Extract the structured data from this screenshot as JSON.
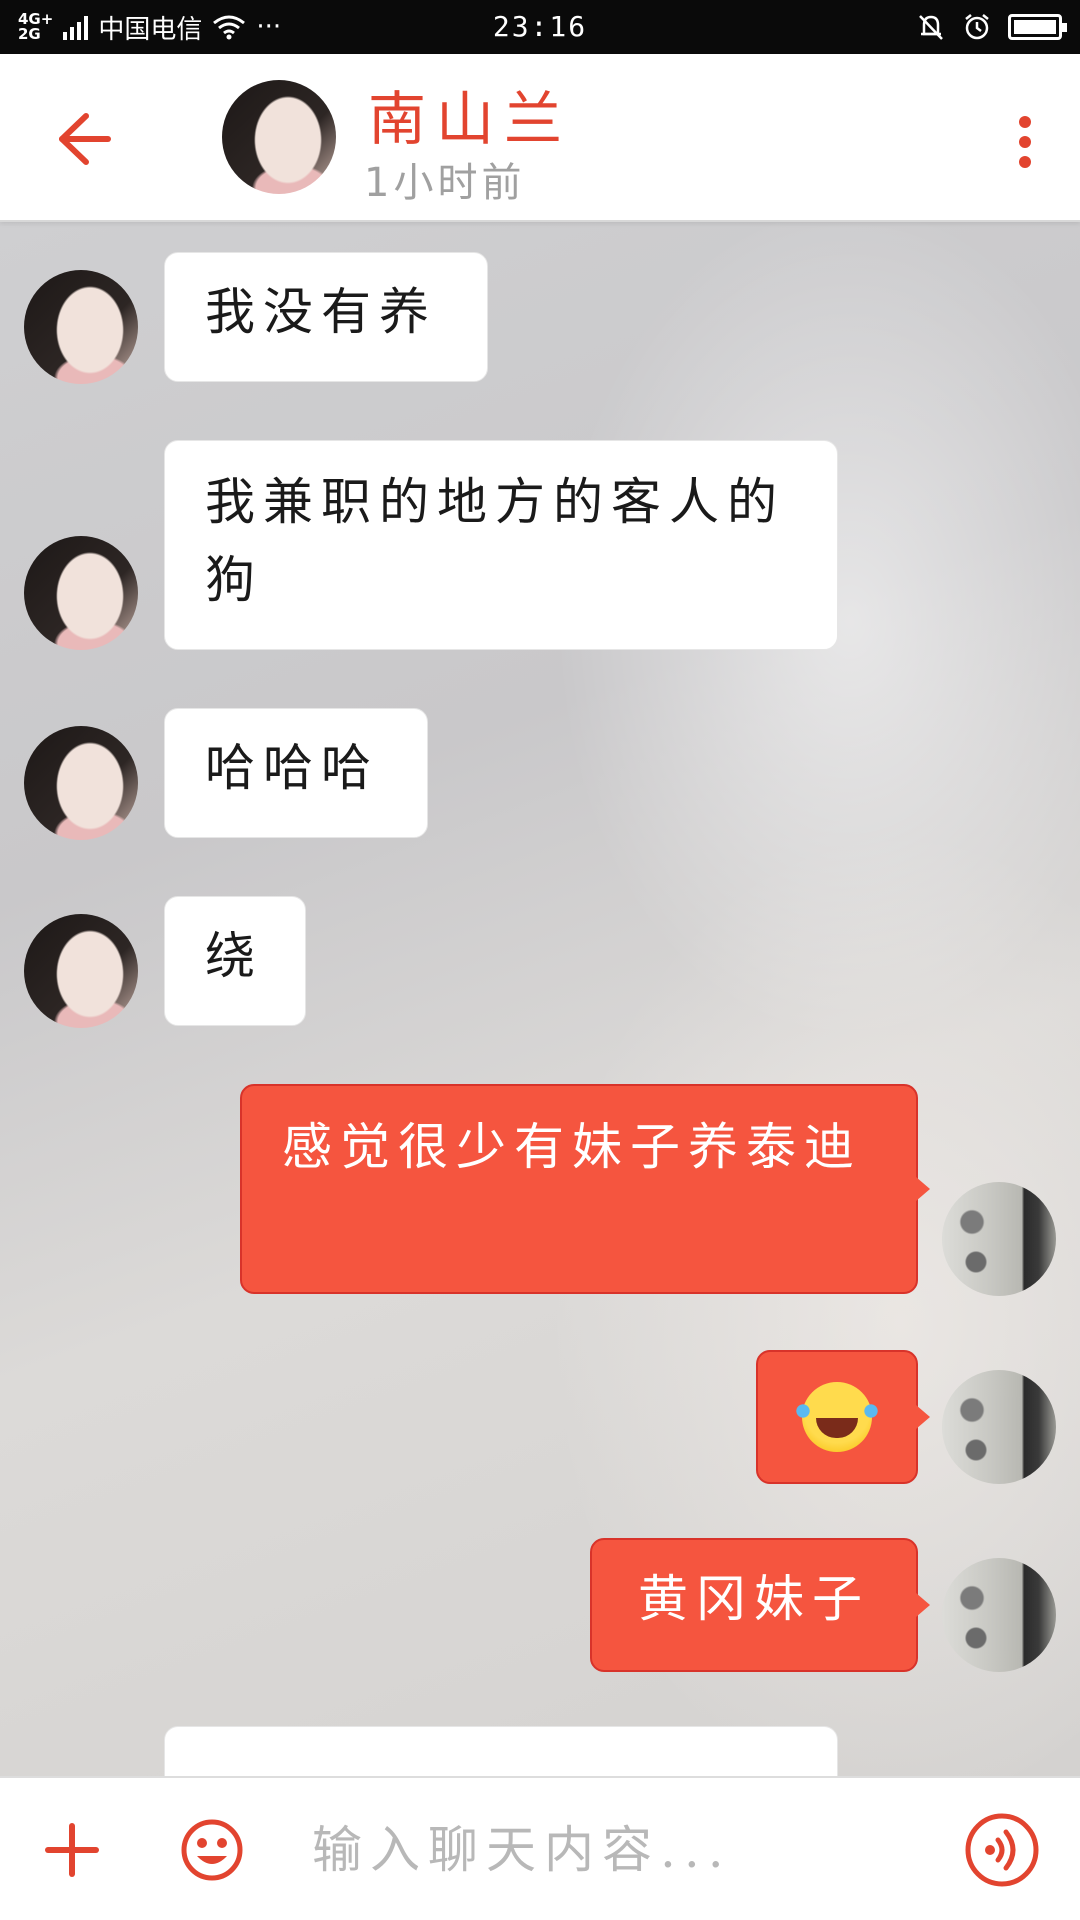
{
  "status_bar": {
    "network": [
      "4G+",
      "2G"
    ],
    "carrier": "中国电信",
    "more": "···",
    "time": "23:16"
  },
  "header": {
    "contact_name": "南山兰",
    "last_seen": "1小时前"
  },
  "messages": [
    {
      "side": "in",
      "text": "我没有养"
    },
    {
      "side": "in",
      "text": "我兼职的地方的客人的狗"
    },
    {
      "side": "in",
      "text": "哈哈哈"
    },
    {
      "side": "in",
      "text": "绕"
    },
    {
      "side": "out",
      "text": "感觉很少有妹子养泰迪"
    },
    {
      "side": "out",
      "text": "",
      "emoji": "face-with-tears-of-joy-icon"
    },
    {
      "side": "out",
      "text": "黄冈妹子"
    }
  ],
  "input": {
    "placeholder": "输入聊天内容..."
  },
  "colors": {
    "accent": "#e2442f",
    "bubble_out": "#f5553f",
    "bubble_in": "#ffffff"
  }
}
